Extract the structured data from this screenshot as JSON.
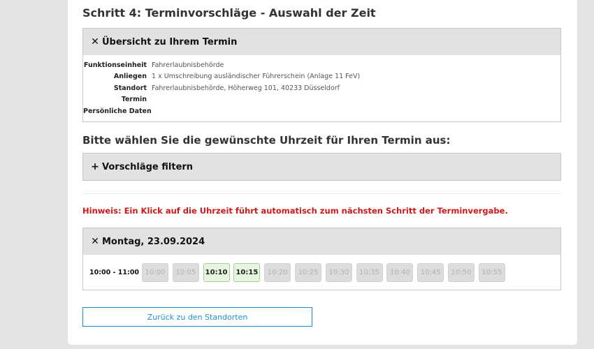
{
  "page": {
    "title": "Schritt 4: Terminvorschläge - Auswahl der Zeit"
  },
  "overview": {
    "header": "Übersicht zu Ihrem Termin",
    "icon": "close-icon",
    "rows": [
      {
        "label": "Funktionseinheit",
        "value": "Fahrerlaubnisbehörde"
      },
      {
        "label": "Anliegen",
        "value": "1 x Umschreibung ausländischer Führerschein (Anlage 11 FeV)"
      },
      {
        "label": "Standort",
        "value": "Fahrerlaubnisbehörde, Höherweg 101, 40233 Düsseldorf"
      },
      {
        "label": "Termin",
        "value": ""
      },
      {
        "label": "Persönliche Daten",
        "value": ""
      }
    ]
  },
  "select_time": {
    "heading": "Bitte wählen Sie die gewünschte Uhrzeit für Ihren Termin aus:"
  },
  "filter": {
    "header": "Vorschläge filtern",
    "icon": "plus-icon"
  },
  "notice": "Hinweis: Ein Klick auf die Uhrzeit führt automatisch zum nächsten Schritt der Terminvergabe.",
  "day": {
    "header": "Montag, 23.09.2024",
    "icon": "close-icon",
    "range": "10:00 - 11:00",
    "slots": [
      {
        "time": "10:00",
        "available": false
      },
      {
        "time": "10:05",
        "available": false
      },
      {
        "time": "10:10",
        "available": true
      },
      {
        "time": "10:15",
        "available": true
      },
      {
        "time": "10:20",
        "available": false
      },
      {
        "time": "10:25",
        "available": false
      },
      {
        "time": "10:30",
        "available": false
      },
      {
        "time": "10:35",
        "available": false
      },
      {
        "time": "10:40",
        "available": false
      },
      {
        "time": "10:45",
        "available": false
      },
      {
        "time": "10:50",
        "available": false
      },
      {
        "time": "10:55",
        "available": false
      }
    ]
  },
  "back_button": "Zurück zu den Standorten",
  "colors": {
    "notice": "#d01818",
    "accent": "#1f8fcf",
    "slot_available_bg": "#e6f5dd",
    "slot_disabled_bg": "#dcdcdc"
  }
}
